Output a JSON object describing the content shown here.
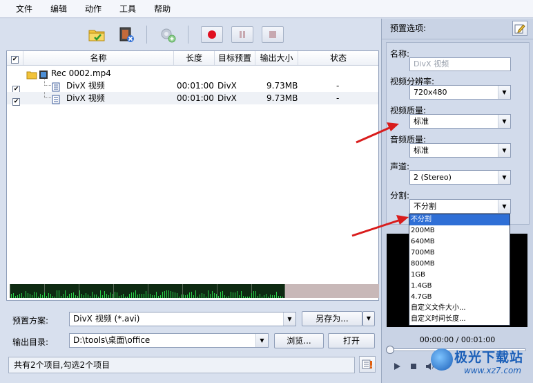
{
  "menu": {
    "items": [
      "文件",
      "编辑",
      "动作",
      "工具",
      "帮助"
    ]
  },
  "toolbar": {
    "icons": [
      "add-folder-icon",
      "remove-video-icon",
      "settings-add-icon",
      "record-icon",
      "pause-icon",
      "stop-icon"
    ],
    "colors": {
      "record": "#e01020",
      "disabled": "#c7a8b0"
    }
  },
  "list": {
    "columns": [
      "名称",
      "长度",
      "目标预置",
      "输出大小",
      "状态"
    ],
    "folder": {
      "name": "Rec 0002.mp4"
    },
    "rows": [
      {
        "name": "DivX 视频",
        "length": "00:01:00",
        "preset": "DivX",
        "size": "9.73MB",
        "status": "-"
      },
      {
        "name": "DivX 视频",
        "length": "00:01:00",
        "preset": "DivX",
        "size": "9.73MB",
        "status": "-"
      }
    ]
  },
  "form": {
    "preset_label": "预置方案:",
    "preset_value": "DivX 视频 (*.avi)",
    "save_as": "另存为...",
    "output_label": "输出目录:",
    "output_value": "D:\\tools\\桌面\\office",
    "browse": "浏览...",
    "open": "打开"
  },
  "status": {
    "text": "共有2个项目,勾选2个项目"
  },
  "panel": {
    "title": "预置选项:",
    "name_label": "名称:",
    "name_value": "DivX 视频",
    "res_label": "视频分辨率:",
    "res_value": "720x480",
    "vq_label": "视频质量:",
    "vq_value": "标准",
    "aq_label": "音频质量:",
    "aq_value": "标准",
    "ch_label": "声道:",
    "ch_value": "2 (Stereo)",
    "split_label": "分割:",
    "split_value": "不分割",
    "split_options": [
      "不分割",
      "200MB",
      "640MB",
      "700MB",
      "800MB",
      "1GB",
      "1.4GB",
      "4.7GB",
      "自定义文件大小...",
      "自定义时间长度..."
    ]
  },
  "player": {
    "timecode": "00:00:00 / 00:01:00"
  },
  "watermark": {
    "text": "极光下载站",
    "url": "www.xz7.com"
  }
}
